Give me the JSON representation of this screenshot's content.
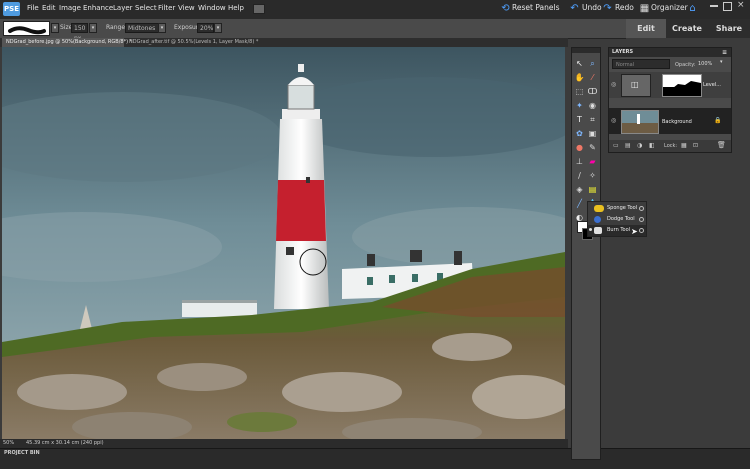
{
  "app": {
    "logo": "PSE"
  },
  "menu": [
    "File",
    "Edit",
    "Image",
    "Enhance",
    "Layer",
    "Select",
    "Filter",
    "View",
    "Window",
    "Help"
  ],
  "top_right": {
    "reset_panels": "Reset Panels",
    "undo": "Undo",
    "redo": "Redo",
    "organizer": "Organizer"
  },
  "options": {
    "size_label": "Size:",
    "size_value": "150 px",
    "range_label": "Range:",
    "range_value": "Midtones",
    "exposure_label": "Exposure:",
    "exposure_value": "20%"
  },
  "mode_tabs": {
    "edit": "Edit",
    "create": "Create",
    "share": "Share"
  },
  "documents": [
    "NDGrad_before.jpg @ 50%(Background, RGB/8*) *",
    "NDGrad_after.tif @ 50.5%(Levels 1, Layer Mask/8) *"
  ],
  "status": {
    "zoom": "50%",
    "dimensions": "45.39 cm x 30.14 cm (240 ppi)"
  },
  "project_bin": "PROJECT BIN",
  "layers_panel": {
    "title": "LAYERS",
    "blend_mode": "Normal",
    "opacity_label": "Opacity:",
    "opacity_value": "100%",
    "lock_label": "Lock:",
    "layers": [
      {
        "name": "Level..."
      },
      {
        "name": "Background"
      }
    ]
  },
  "tool_flyout": [
    "Sponge Tool",
    "Dodge Tool",
    "Burn Tool"
  ],
  "colors": {
    "accent": "#4fa0ff",
    "panel": "#4a4a4a",
    "dark": "#2a2a2a"
  }
}
